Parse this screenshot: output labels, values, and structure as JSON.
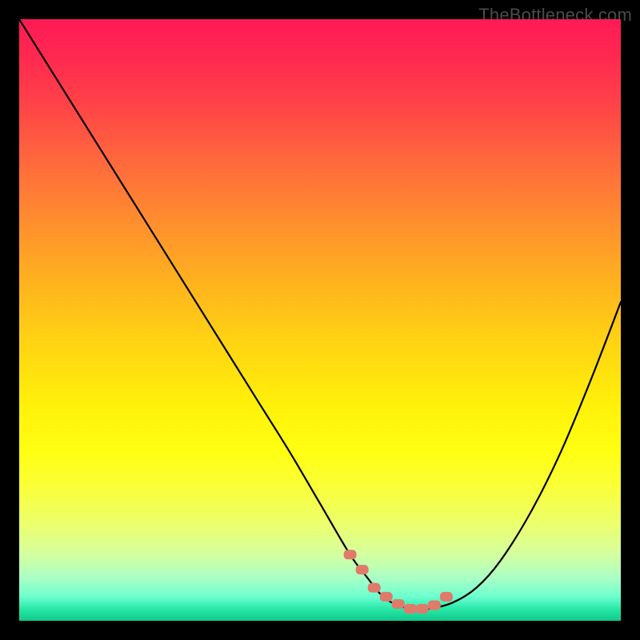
{
  "watermark": "TheBottleneck.com",
  "colors": {
    "page_bg": "#000000",
    "gradient_top": "#ff1a56",
    "gradient_bottom": "#11c98a",
    "curve_stroke": "#000000",
    "marker_fill": "#e07a6a"
  },
  "chart_data": {
    "type": "line",
    "title": "",
    "xlabel": "",
    "ylabel": "",
    "xlim": [
      0,
      100
    ],
    "ylim": [
      0,
      100
    ],
    "grid": false,
    "series": [
      {
        "name": "bottleneck-curve",
        "x": [
          0,
          5,
          10,
          15,
          20,
          25,
          30,
          35,
          40,
          45,
          50,
          55,
          58,
          60,
          62,
          65,
          68,
          72,
          76,
          80,
          85,
          90,
          95,
          100
        ],
        "values": [
          100,
          92,
          84,
          76,
          68,
          60,
          52,
          44,
          36,
          28,
          19.5,
          11,
          7,
          4.5,
          3,
          2,
          2,
          3,
          5.5,
          10,
          18,
          28,
          40,
          53
        ]
      }
    ],
    "markers": {
      "name": "highlight-points",
      "x": [
        55,
        57,
        59,
        61,
        63,
        65,
        67,
        69,
        71
      ],
      "values": [
        11,
        8.5,
        5.5,
        4,
        2.8,
        2,
        2,
        2.6,
        4
      ],
      "shape": "rounded-rect"
    }
  }
}
